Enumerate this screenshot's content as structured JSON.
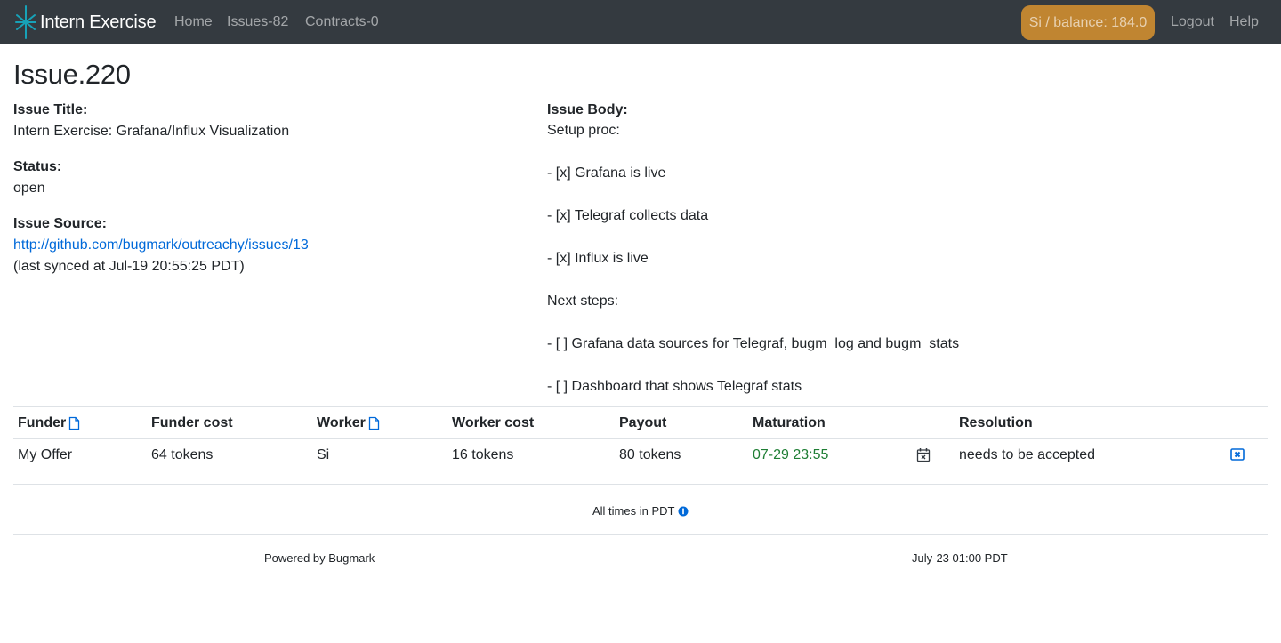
{
  "navbar": {
    "brand": "Intern Exercise",
    "links": [
      "Home",
      "Issues-82",
      "Contracts-0"
    ],
    "balance": "Si / balance: 184.0",
    "logout": "Logout",
    "help": "Help"
  },
  "issue": {
    "title": "Issue.220",
    "title_label": "Issue Title:",
    "title_value": "Intern Exercise: Grafana/Influx Visualization",
    "status_label": "Status:",
    "status_value": "open",
    "source_label": "Issue Source:",
    "source_url": "http://github.com/bugmark/outreachy/issues/13",
    "synced": "(last synced at Jul-19 20:55:25 PDT)",
    "body_label": "Issue Body:",
    "body_lines": [
      "Setup proc:",
      "- [x] Grafana is live",
      "- [x] Telegraf collects data",
      "- [x] Influx is live",
      "Next steps:",
      "- [ ] Grafana data sources for Telegraf, bugm_log and bugm_stats",
      "- [ ] Dashboard that shows Telegraf stats"
    ]
  },
  "offers_table": {
    "headers": [
      "Funder",
      "Funder cost",
      "Worker",
      "Worker cost",
      "Payout",
      "Maturation",
      "Resolution"
    ],
    "rows": [
      {
        "funder": "My Offer",
        "funder_cost": "64 tokens",
        "worker": "Si",
        "worker_cost": "16 tokens",
        "payout": "80 tokens",
        "maturation": "07-29 23:55",
        "resolution": "needs to be accepted"
      }
    ]
  },
  "timezone_note": "All times in PDT",
  "footer": {
    "powered_by": "Powered by Bugmark",
    "timestamp": "July-23 01:00 PDT"
  },
  "colors": {
    "navbar_bg": "#343a40",
    "balance_bg": "#c08531",
    "link": "#0069d9",
    "maturation": "#1e7e34"
  },
  "icons": {
    "brand": "sparkle-icon",
    "doc": "document-icon",
    "calendar": "calendar-x-icon",
    "cancel": "close-box-icon",
    "info": "info-circle-icon"
  }
}
